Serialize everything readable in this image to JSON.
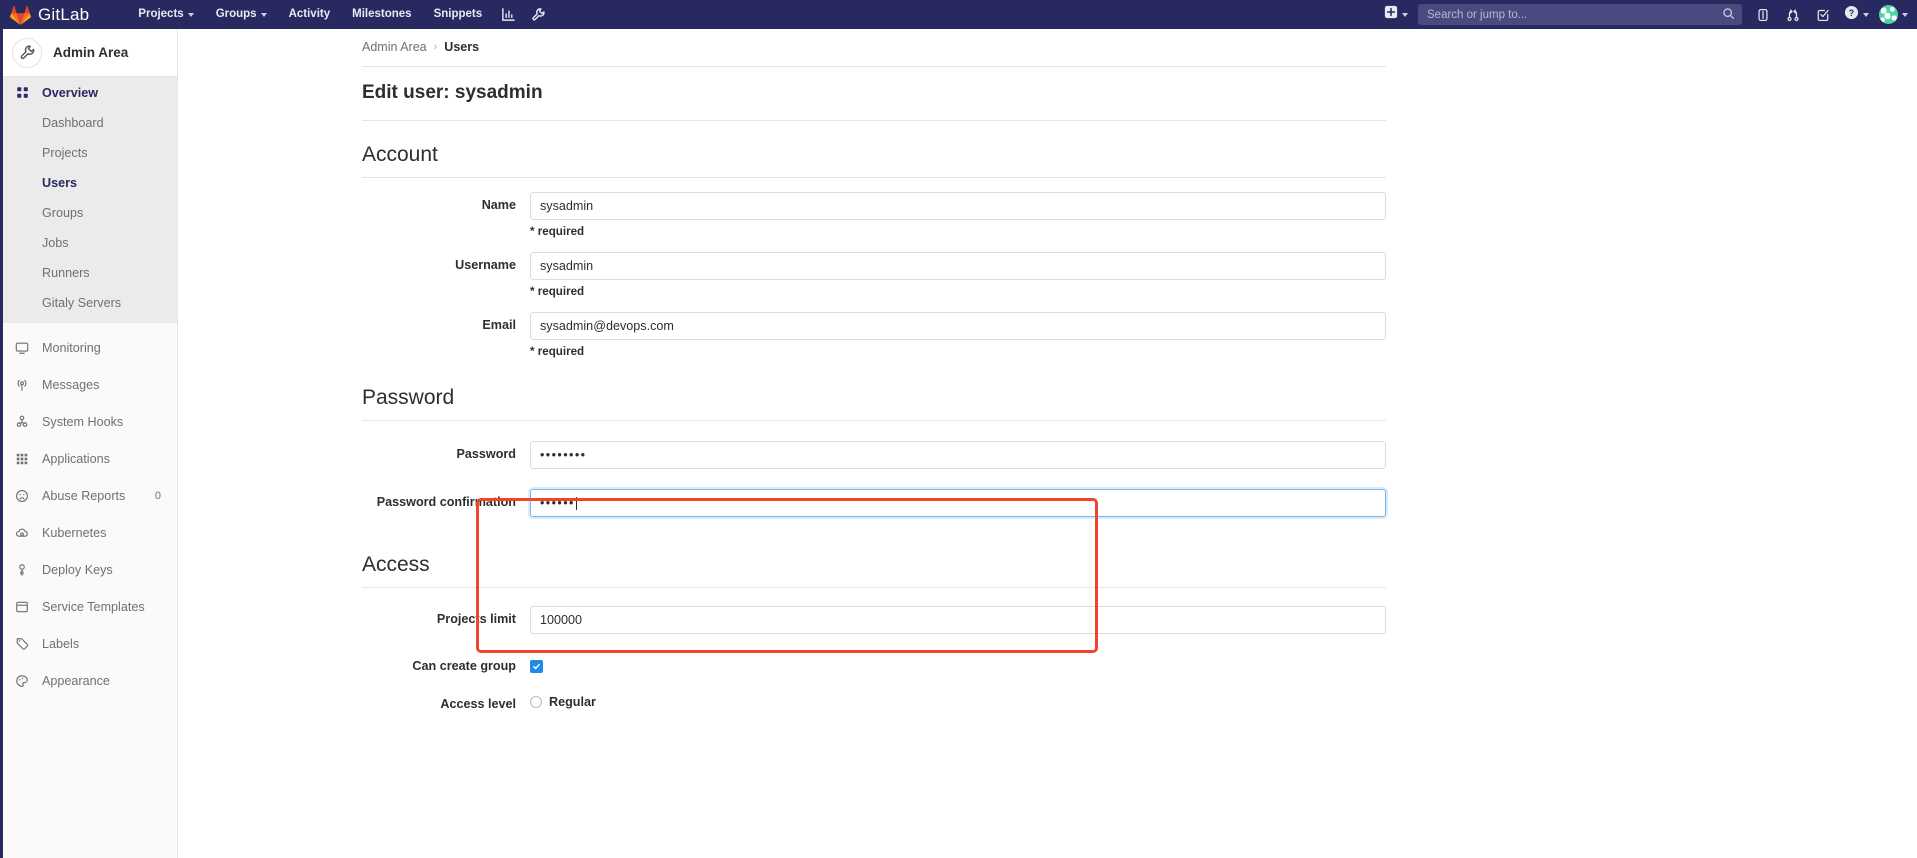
{
  "navbar": {
    "brand": "GitLab",
    "logo_icon": "gitlab-tanuki-icon",
    "links": [
      {
        "label": "Projects",
        "icon": "chevron-down-icon",
        "has_caret": true
      },
      {
        "label": "Groups",
        "icon": "chevron-down-icon",
        "has_caret": true
      },
      {
        "label": "Activity",
        "has_caret": false
      },
      {
        "label": "Milestones",
        "has_caret": false
      },
      {
        "label": "Snippets",
        "has_caret": false
      }
    ],
    "icon_buttons": [
      {
        "name": "analytics-chart-icon"
      },
      {
        "name": "wrench-admin-icon"
      }
    ],
    "plus_button": {
      "name": "plus-square-icon",
      "caret": true
    },
    "search": {
      "placeholder": "Search or jump to...",
      "value": "",
      "icon": "search-icon"
    },
    "right_icons": [
      {
        "name": "issues-icon"
      },
      {
        "name": "merge-requests-icon"
      },
      {
        "name": "todos-icon"
      },
      {
        "name": "help-question-icon",
        "caret": true
      }
    ],
    "avatar": {
      "name": "user-avatar",
      "caret": true
    }
  },
  "sidebar": {
    "context": {
      "title": "Admin Area",
      "icon": "wrench-icon"
    },
    "overview": {
      "label": "Overview",
      "icon": "overview-grid-icon",
      "active": true,
      "items": [
        {
          "label": "Dashboard",
          "active": false
        },
        {
          "label": "Projects",
          "active": false
        },
        {
          "label": "Users",
          "active": true
        },
        {
          "label": "Groups",
          "active": false
        },
        {
          "label": "Jobs",
          "active": false
        },
        {
          "label": "Runners",
          "active": false
        },
        {
          "label": "Gitaly Servers",
          "active": false
        }
      ]
    },
    "items": [
      {
        "label": "Monitoring",
        "icon": "monitor-icon",
        "badge": ""
      },
      {
        "label": "Messages",
        "icon": "broadcast-icon",
        "badge": ""
      },
      {
        "label": "System Hooks",
        "icon": "hook-icon",
        "badge": ""
      },
      {
        "label": "Applications",
        "icon": "applications-grid-icon",
        "badge": ""
      },
      {
        "label": "Abuse Reports",
        "icon": "abuse-face-icon",
        "badge": "0"
      },
      {
        "label": "Kubernetes",
        "icon": "kubernetes-cloud-icon",
        "badge": ""
      },
      {
        "label": "Deploy Keys",
        "icon": "key-icon",
        "badge": ""
      },
      {
        "label": "Service Templates",
        "icon": "template-icon",
        "badge": ""
      },
      {
        "label": "Labels",
        "icon": "labels-tag-icon",
        "badge": ""
      },
      {
        "label": "Appearance",
        "icon": "appearance-icon",
        "badge": ""
      }
    ]
  },
  "breadcrumb": {
    "root": "Admin Area",
    "separator": "›",
    "current": "Users"
  },
  "page": {
    "title": "Edit user: sysadmin"
  },
  "account": {
    "heading": "Account",
    "name": {
      "label": "Name",
      "value": "sysadmin",
      "hint": "* required"
    },
    "username": {
      "label": "Username",
      "value": "sysadmin",
      "hint": "* required"
    },
    "email": {
      "label": "Email",
      "value": "sysadmin@devops.com",
      "hint": "* required"
    }
  },
  "password": {
    "heading": "Password",
    "password": {
      "label": "Password",
      "masked_value": "••••••••",
      "length": 8,
      "focused": false
    },
    "confirmation": {
      "label": "Password confirmation",
      "masked_value": "••••••",
      "length": 6,
      "focused": true
    }
  },
  "access": {
    "heading": "Access",
    "projects_limit": {
      "label": "Projects limit",
      "value": "100000"
    },
    "can_create_group": {
      "label": "Can create group",
      "checked": true,
      "icon": "checkmark-icon"
    },
    "access_level": {
      "label": "Access level",
      "option_label": "Regular",
      "selected": false
    }
  },
  "annotation": {
    "color": "#ef462b",
    "target": "password-fields-group"
  }
}
